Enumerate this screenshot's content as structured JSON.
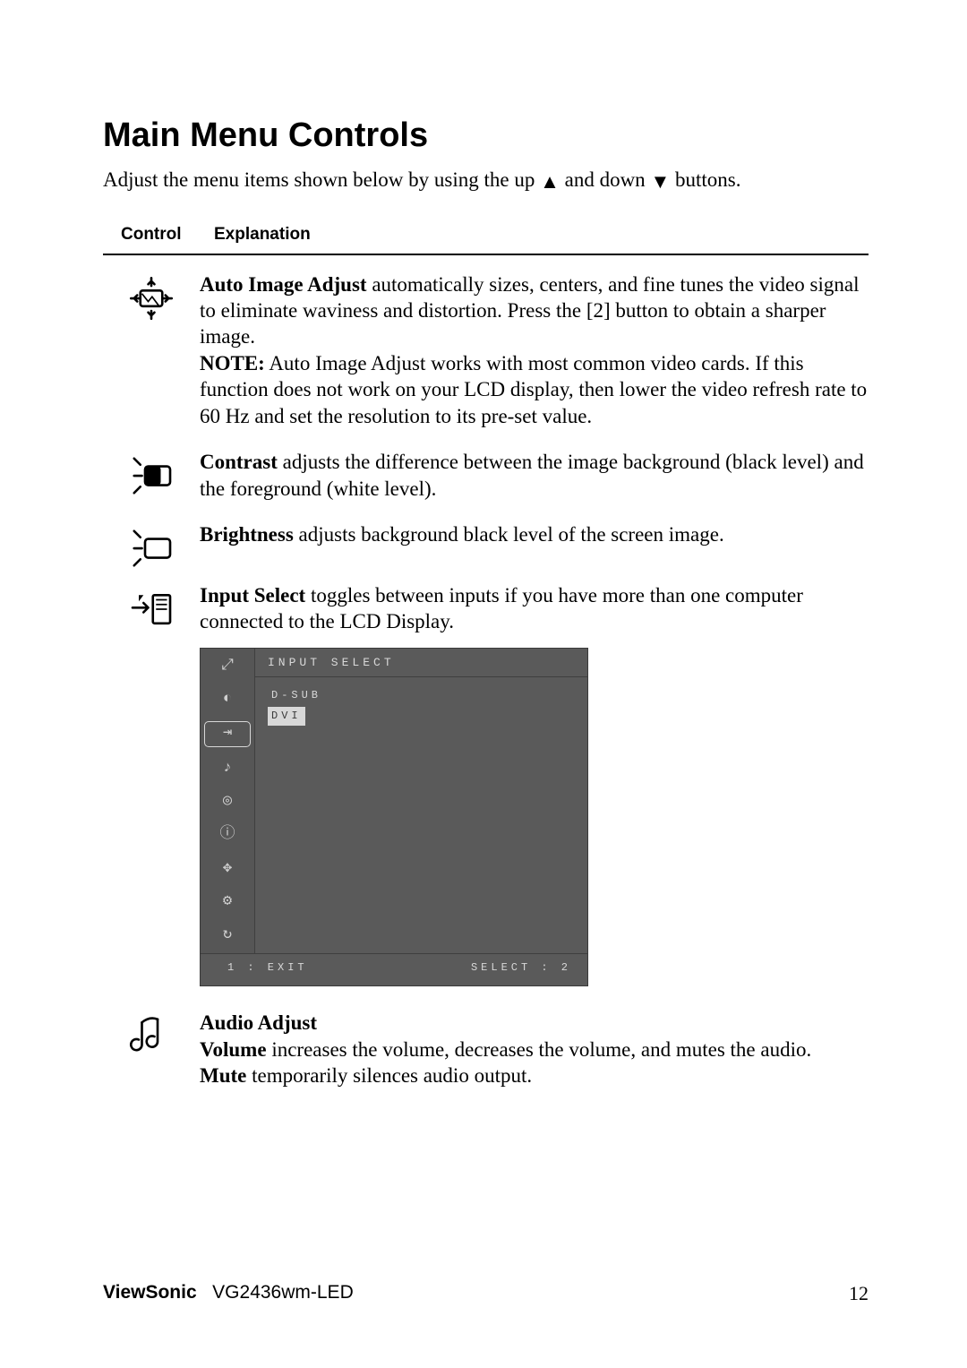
{
  "heading": "Main Menu Controls",
  "intro_before_up": "Adjust the menu items shown below by using the up ",
  "intro_mid": " and down ",
  "intro_after_down": " buttons.",
  "header_col_control": "Control",
  "header_col_explanation": "Explanation",
  "controls": {
    "auto_image_adjust": {
      "name": "Auto Image Adjust",
      "body": " automatically sizes, centers, and fine tunes the video signal to eliminate waviness and distortion. Press the [2] button to obtain a sharper image.",
      "note_label": "NOTE:",
      "note_body": " Auto Image Adjust works with most common video cards. If this function does not work on your LCD display, then lower the video refresh rate to 60 Hz and set the resolution to its pre-set value."
    },
    "contrast": {
      "name": "Contrast",
      "body": " adjusts the difference between the image background (black level) and the foreground (white level)."
    },
    "brightness": {
      "name": "Brightness",
      "body": " adjusts background black level of the screen image."
    },
    "input_select": {
      "name": "Input Select",
      "body": " toggles between inputs if you have more than one computer connected to the LCD Display."
    },
    "audio_adjust": {
      "name": "Audio Adjust",
      "volume_label": "Volume",
      "volume_body": " increases the volume, decreases the volume, and mutes the audio.",
      "mute_label": "Mute",
      "mute_body": " temporarily silences audio output."
    }
  },
  "osd": {
    "title": "INPUT SELECT",
    "options": [
      "D-SUB",
      "DVI"
    ],
    "selected_index": 1,
    "footer_left": "1 : EXIT",
    "footer_right": "SELECT : 2"
  },
  "footer": {
    "brand": "ViewSonic",
    "model": "VG2436wm-LED",
    "page": "12"
  }
}
